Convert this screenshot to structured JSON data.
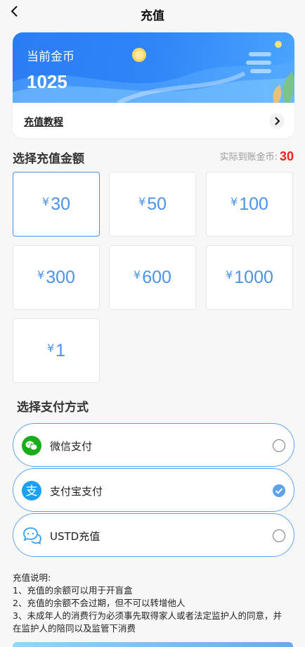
{
  "header": {
    "title": "充值",
    "back_icon": "chevron-left-icon"
  },
  "balance": {
    "label": "当前金币",
    "value": "1025",
    "tutorial_label": "充值教程",
    "tutorial_icon": "chevron-right-icon"
  },
  "amounts": {
    "title": "选择充值金额",
    "arrive_label": "实际到账金币:",
    "arrive_value": "30",
    "currency": "¥",
    "options": [
      "30",
      "50",
      "100",
      "300",
      "600",
      "1000",
      "1"
    ],
    "selected": "30"
  },
  "payment": {
    "title": "选择支付方式",
    "methods": [
      {
        "label": "微信支付",
        "icon": "wechat-pay-icon",
        "selected": false
      },
      {
        "label": "支付宝支付",
        "icon": "alipay-icon",
        "selected": true
      },
      {
        "label": "USTD充值",
        "icon": "ustd-chat-icon",
        "selected": false
      }
    ]
  },
  "notes": {
    "title": "充值说明:",
    "lines": [
      "1、充值的余额可以用于开盲盒",
      "2、充值的余额不会过期，但不可以转增他人",
      "3、未成年人的消费行为必须事先取得家人或者法定监护人的同意，并在监护人的陪同以及监管下消费"
    ]
  },
  "colors": {
    "accent": "#4b93e8",
    "highlight": "#e22222",
    "banner": "#2f86f7",
    "wechat": "#1aad19",
    "alipay": "#1ea0f0"
  }
}
